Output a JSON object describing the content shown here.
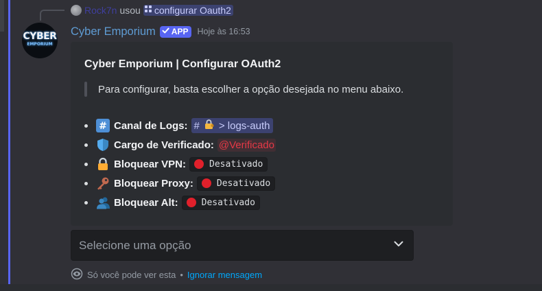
{
  "reply": {
    "user": "Rock7n",
    "verb": "usou",
    "command": "configurar Oauth2"
  },
  "message": {
    "author": "Cyber Emporium",
    "badge": "APP",
    "timestamp": "Hoje às 16:53",
    "avatar_text": "CYBER",
    "avatar_subtext": "EMPORIUM"
  },
  "embed": {
    "title": "Cyber Emporium | Configurar OAuth2",
    "description": "Para configurar, basta escolher a opção desejada no menu abaixo.",
    "items": [
      {
        "icon": "hashtag-icon",
        "label": "Canal de Logs:",
        "value_hash": "#",
        "value_name": "> logs-auth"
      },
      {
        "icon": "shield-icon",
        "label": "Cargo de Verificado:",
        "value": "@Verificado"
      },
      {
        "icon": "lock-icon",
        "label": "Bloquear VPN:",
        "value": "Desativado"
      },
      {
        "icon": "key-icon",
        "label": "Bloquear Proxy:",
        "value": "Desativado"
      },
      {
        "icon": "user-icon",
        "label": "Bloquear Alt:",
        "value": "Desativado"
      }
    ]
  },
  "select": {
    "placeholder": "Selecione uma opção"
  },
  "footer": {
    "notice": "Só você pode ver esta",
    "separator": "•",
    "dismiss": "Ignorar mensagem"
  },
  "colors": {
    "accent": "#5865f2",
    "author": "#5f9cd4",
    "role": "#e63946",
    "link": "#00a8fc",
    "status_off": "#e0202b"
  }
}
